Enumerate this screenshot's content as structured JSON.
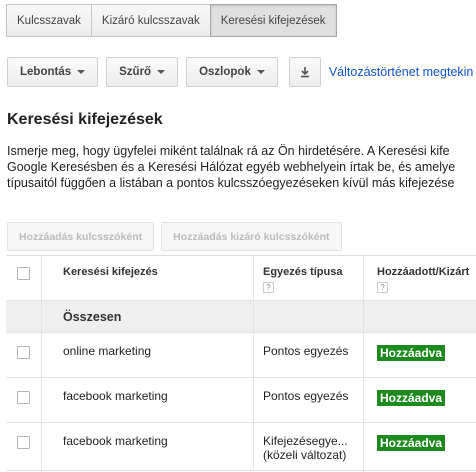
{
  "tabs": [
    "Kulcsszavak",
    "Kizáró kulcsszavak",
    "Keresési kifejezések"
  ],
  "active_tab": 2,
  "toolbar": {
    "segment": "Lebontás",
    "filter": "Szűrő",
    "columns": "Oszlopok",
    "download_icon": "download-icon",
    "history_link": "Változástörténet megtekin"
  },
  "page_title": "Keresési kifejezések",
  "description": [
    "Ismerje meg, hogy ügyfelei miként találnak rá az Ön hirdetésére. A Keresési kife",
    "Google Keresésben és a Keresési Hálózat egyéb webhelyein írtak be, és amelye",
    "típusaitól függően a listában a pontos kulcsszóegyezéseken kívül más kifejezése"
  ],
  "actions": {
    "add_keyword": "Hozzáadás kulcsszóként",
    "add_negative": "Hozzáadás kizáró kulcsszóként"
  },
  "table": {
    "headers": {
      "search_term": "Keresési kifejezés",
      "match_type": "Egyezés típusa",
      "added_excluded": "Hozzáadott/Kizárt",
      "help": "?"
    },
    "total_label": "Összesen",
    "rows": [
      {
        "term": "online marketing",
        "match": "Pontos egyezés",
        "match2": "",
        "status": "Hozzáadva"
      },
      {
        "term": "facebook marketing",
        "match": "Pontos egyezés",
        "match2": "",
        "status": "Hozzáadva"
      },
      {
        "term": "facebook marketing",
        "match": "Kifejezésegye...",
        "match2": "(közeli változat)",
        "status": "Hozzáadva"
      }
    ]
  },
  "colors": {
    "status_green": "#1c8a1c",
    "link_blue": "#15c"
  }
}
